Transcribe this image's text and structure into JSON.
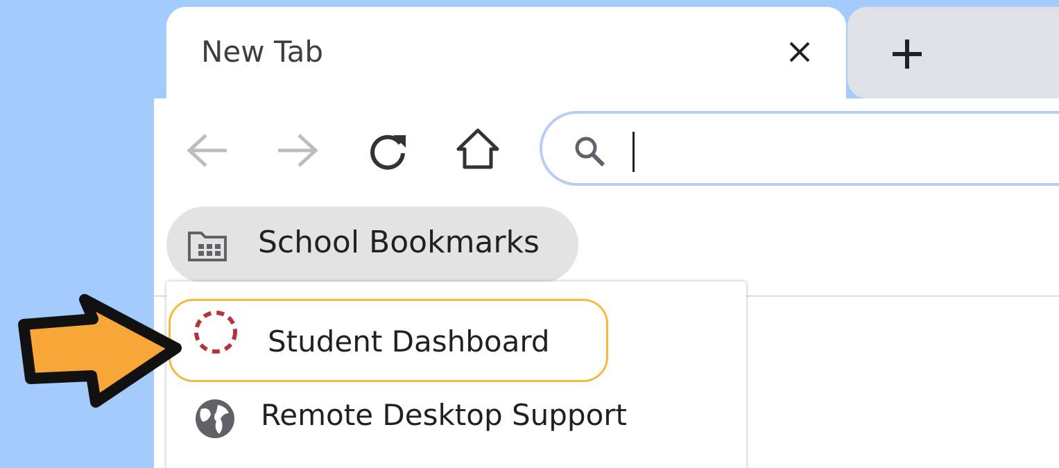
{
  "browser": {
    "tab": {
      "title": "New Tab"
    },
    "omnibox": {
      "value": "",
      "placeholder": ""
    },
    "bookmarks_bar": {
      "folder_label": "School Bookmarks"
    },
    "dropdown": {
      "items": [
        {
          "label": "Student Dashboard",
          "icon": "dashed-circle-icon",
          "highlighted": true
        },
        {
          "label": "Remote Desktop Support",
          "icon": "globe-icon",
          "highlighted": false
        }
      ]
    }
  },
  "colors": {
    "background": "#a3cbfb",
    "highlight_border": "#f7b93b",
    "arrow_fill": "#f7a737",
    "dashboard_icon": "#b2353a"
  }
}
